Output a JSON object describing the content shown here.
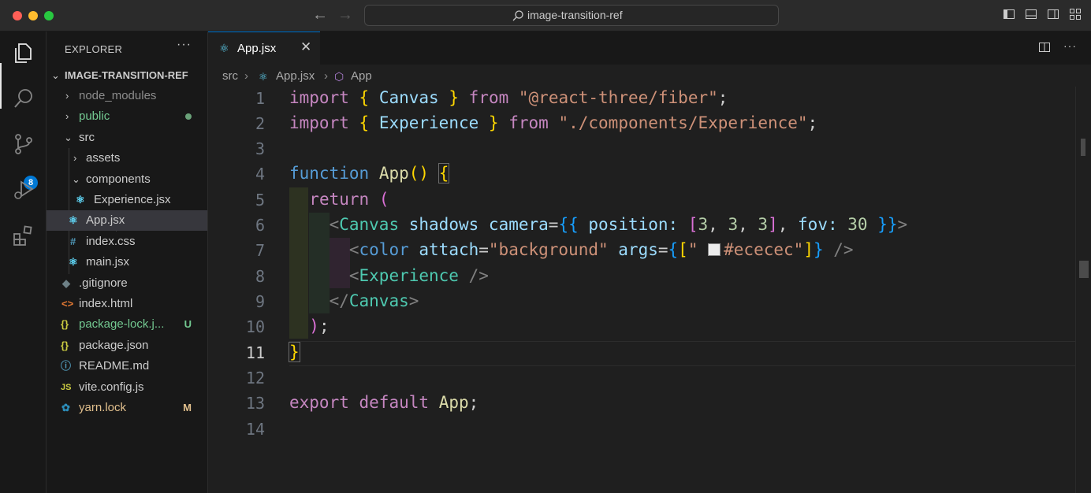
{
  "window": {
    "search_text": "image-transition-ref"
  },
  "activity": {
    "scm_badge": "8"
  },
  "explorer": {
    "header": "EXPLORER",
    "more": "···",
    "root": "IMAGE-TRANSITION-REF",
    "items": [
      {
        "label": "node_modules",
        "color": "#8c8c8c"
      },
      {
        "label": "public",
        "color": "#73c991"
      },
      {
        "label": "src",
        "color": "#cccccc"
      },
      {
        "label": "assets",
        "color": "#cccccc"
      },
      {
        "label": "components",
        "color": "#cccccc"
      },
      {
        "label": "Experience.jsx",
        "color": "#cccccc"
      },
      {
        "label": "App.jsx",
        "color": "#cccccc"
      },
      {
        "label": "index.css",
        "color": "#cccccc"
      },
      {
        "label": "main.jsx",
        "color": "#cccccc"
      },
      {
        "label": ".gitignore",
        "color": "#cccccc"
      },
      {
        "label": "index.html",
        "color": "#cccccc"
      },
      {
        "label": "package-lock.j...",
        "color": "#73c991",
        "badge": "U"
      },
      {
        "label": "package.json",
        "color": "#cccccc"
      },
      {
        "label": "README.md",
        "color": "#cccccc"
      },
      {
        "label": "vite.config.js",
        "color": "#cccccc"
      },
      {
        "label": "yarn.lock",
        "color": "#e2c08d",
        "badge": "M"
      }
    ]
  },
  "editor": {
    "tab_label": "App.jsx",
    "breadcrumb": [
      "src",
      "App.jsx",
      "App"
    ],
    "line_numbers": [
      "1",
      "2",
      "3",
      "4",
      "5",
      "6",
      "7",
      "8",
      "9",
      "10",
      "11",
      "12",
      "13",
      "14"
    ],
    "active_line": "11",
    "code": {
      "l1": [
        "import",
        "{",
        "Canvas",
        "}",
        "from",
        "\"@react-three/fiber\"",
        ";"
      ],
      "l2": [
        "import",
        "{",
        "Experience",
        "}",
        "from",
        "\"./components/Experience\"",
        ";"
      ],
      "l4": [
        "function",
        "App",
        "()",
        "{"
      ],
      "l5": [
        "return",
        "("
      ],
      "l6": [
        "<",
        "Canvas",
        "shadows",
        "camera",
        "=",
        "{{",
        "position",
        ":",
        "[",
        "3",
        "3",
        "3",
        "fov",
        "30",
        "}}",
        ">"
      ],
      "l7": [
        "<",
        "color",
        "attach",
        "=",
        "\"background\"",
        "args",
        "{",
        "[",
        "\"",
        "#ececec",
        "\"",
        "]",
        "}",
        "/>"
      ],
      "l8": [
        "<",
        "Experience",
        "/>"
      ],
      "l9": [
        "</",
        "Canvas",
        ">"
      ],
      "l10": [
        ")",
        ";"
      ],
      "l11": [
        "}"
      ],
      "l13": [
        "export",
        "default",
        "App",
        ";"
      ]
    }
  }
}
